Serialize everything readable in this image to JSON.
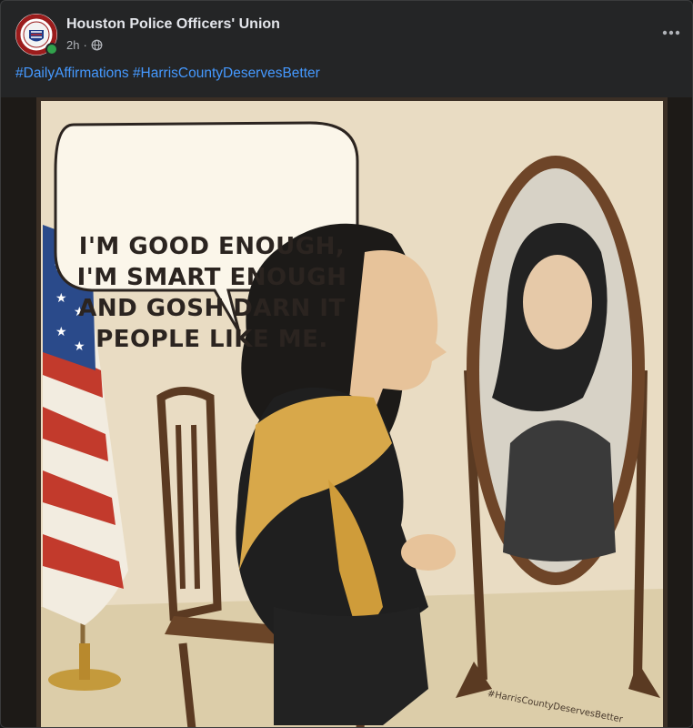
{
  "post": {
    "page_name": "Houston Police Officers' Union",
    "timestamp": "2h",
    "separator": "·",
    "audience_icon": "globe-icon",
    "more_icon": "more-options-icon",
    "hashtags": [
      "#DailyAffirmations",
      "#HarrisCountyDeservesBetter"
    ]
  },
  "image": {
    "speech_bubble": [
      "I'M GOOD ENOUGH,",
      "I'M SMART ENOUGH",
      "AND GOSH DARN IT",
      "PEOPLE LIKE ME."
    ],
    "watermark": "#HarrisCountyDeservesBetter"
  },
  "colors": {
    "background": "#242526",
    "hashtag": "#4599ff",
    "online": "#31a24c",
    "poster_paper": "#e9dcc3"
  }
}
